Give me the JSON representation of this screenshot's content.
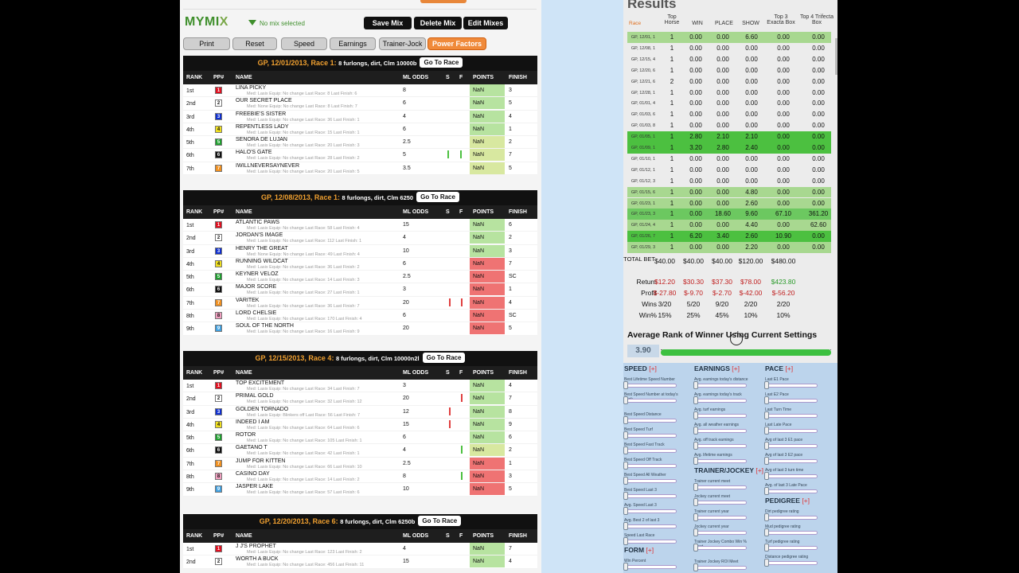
{
  "toolbar": {
    "logo_main": "MYMI",
    "logo_x": "X",
    "no_mix": "No mix selected",
    "save_mix": "Save Mix",
    "delete_mix": "Delete Mix",
    "edit_mixes": "Edit Mixes",
    "filters": [
      "Print",
      "Reset",
      "Speed",
      "Earnings",
      "Trainer-Jock",
      "Power Factors"
    ]
  },
  "columns": [
    "RANK",
    "PP#",
    "NAME",
    "ML ODDS",
    "S",
    "F",
    "POINTS",
    "FINISH"
  ],
  "races": [
    {
      "title": "GP, 12/01/2013, Race 1:",
      "dist": "8 furlongs, dirt, Clm 10000b",
      "go": "Go To Race",
      "horses": [
        {
          "rank": "1st",
          "pp": "1",
          "name": "LINA PICKY",
          "med": "Med: Lasix   Equip: No change   Last Race: 8   Last Finish: 6",
          "odds": "8",
          "points": "NaN",
          "finish": "3",
          "pc": "g",
          "ppc": "#e01020"
        },
        {
          "rank": "2nd",
          "pp": "2",
          "name": "OUR SECRET PLACE",
          "med": "Med: None   Equip: No change   Last Race: 8   Last Finish: 7",
          "odds": "6",
          "points": "NaN",
          "finish": "5",
          "pc": "g",
          "ppc": "#fff"
        },
        {
          "rank": "3rd",
          "pp": "3",
          "name": "FREEBIE'S SISTER",
          "med": "Med: Lasix   Equip: No change   Last Race: 36   Last Finish: 1",
          "odds": "4",
          "points": "NaN",
          "finish": "4",
          "pc": "g",
          "ppc": "#1030d0"
        },
        {
          "rank": "4th",
          "pp": "4",
          "name": "REPENTLESS LADY",
          "med": "Med: Lasix   Equip: No change   Last Race: 15   Last Finish: 1",
          "odds": "6",
          "points": "NaN",
          "finish": "1",
          "pc": "g",
          "ppc": "#f0e020"
        },
        {
          "rank": "5th",
          "pp": "5",
          "name": "SENORA DE LUJAN",
          "med": "Med: Lasix   Equip: No change   Last Race: 20   Last Finish: 3",
          "odds": "2.5",
          "points": "NaN",
          "finish": "2",
          "pc": "y",
          "ppc": "#20a030"
        },
        {
          "rank": "6th",
          "pp": "6",
          "name": "HALO'S GATE",
          "med": "Med: Lasix   Equip: No change   Last Race: 28   Last Finish: 2",
          "odds": "5",
          "points": "NaN",
          "finish": "7",
          "pc": "y",
          "ppc": "#111"
        },
        {
          "rank": "7th",
          "pp": "7",
          "name": "IWILLNEVERSAYNEVER",
          "med": "Med: Lasix   Equip: No change   Last Race: 20   Last Finish: 5",
          "odds": "3.5",
          "points": "NaN",
          "finish": "5",
          "pc": "y",
          "ppc": "#f09020"
        }
      ]
    },
    {
      "title": "GP, 12/08/2013, Race 1:",
      "dist": "8 furlongs, dirt, Clm 6250",
      "go": "Go To Race",
      "horses": [
        {
          "rank": "1st",
          "pp": "1",
          "name": "ATLANTIC PAWS",
          "med": "Med: Lasix   Equip: No change   Last Race: 58   Last Finish: 4",
          "odds": "15",
          "points": "NaN",
          "finish": "6",
          "pc": "g",
          "ppc": "#e01020"
        },
        {
          "rank": "2nd",
          "pp": "2",
          "name": "JORDAN'S IMAGE",
          "med": "Med: Lasix   Equip: No change   Last Race: 112   Last Finish: 1",
          "odds": "4",
          "points": "NaN",
          "finish": "2",
          "pc": "g",
          "ppc": "#fff"
        },
        {
          "rank": "3rd",
          "pp": "3",
          "name": "HENRY THE GREAT",
          "med": "Med: None   Equip: No change   Last Race: 49   Last Finish: 4",
          "odds": "10",
          "points": "NaN",
          "finish": "3",
          "pc": "g",
          "ppc": "#1030d0"
        },
        {
          "rank": "4th",
          "pp": "4",
          "name": "RUNNING WILDCAT",
          "med": "Med: Lasix   Equip: No change   Last Race: 36   Last Finish: 2",
          "odds": "6",
          "points": "NaN",
          "finish": "7",
          "pc": "r",
          "ppc": "#f0e020"
        },
        {
          "rank": "5th",
          "pp": "5",
          "name": "KEYNER VELOZ",
          "med": "Med: Lasix   Equip: No change   Last Race: 14   Last Finish: 3",
          "odds": "2.5",
          "points": "NaN",
          "finish": "SC",
          "pc": "r",
          "ppc": "#20a030"
        },
        {
          "rank": "6th",
          "pp": "6",
          "name": "MAJOR SCORE",
          "med": "Med: Lasix   Equip: No change   Last Race: 27   Last Finish: 1",
          "odds": "3",
          "points": "NaN",
          "finish": "1",
          "pc": "r",
          "ppc": "#111"
        },
        {
          "rank": "7th",
          "pp": "7",
          "name": "VARITEK",
          "med": "Med: Lasix   Equip: No change   Last Race: 36   Last Finish: 7",
          "odds": "20",
          "points": "NaN",
          "finish": "4",
          "pc": "r",
          "ppc": "#f09020"
        },
        {
          "rank": "8th",
          "pp": "8",
          "name": "LORD CHELSIE",
          "med": "Med: Lasix   Equip: No change   Last Race: 170   Last Finish: 4",
          "odds": "6",
          "points": "NaN",
          "finish": "SC",
          "pc": "r",
          "ppc": "#f0a0c0"
        },
        {
          "rank": "9th",
          "pp": "9",
          "name": "SOUL OF THE NORTH",
          "med": "Med: Lasix   Equip: No change   Last Race: 16   Last Finish: 9",
          "odds": "20",
          "points": "NaN",
          "finish": "5",
          "pc": "r",
          "ppc": "#40a0e0"
        }
      ]
    },
    {
      "title": "GP, 12/15/2013, Race 4:",
      "dist": "8 furlongs, dirt, Clm 10000n2l",
      "go": "Go To Race",
      "horses": [
        {
          "rank": "1st",
          "pp": "1",
          "name": "TOP EXCITEMENT",
          "med": "Med: Lasix   Equip: No change   Last Race: 34   Last Finish: 7",
          "odds": "3",
          "points": "NaN",
          "finish": "4",
          "pc": "g",
          "ppc": "#e01020"
        },
        {
          "rank": "2nd",
          "pp": "2",
          "name": "PRIMAL GOLD",
          "med": "Med: Lasix   Equip: No change   Last Race: 32   Last Finish: 12",
          "odds": "20",
          "points": "NaN",
          "finish": "7",
          "pc": "g",
          "ppc": "#fff"
        },
        {
          "rank": "3rd",
          "pp": "3",
          "name": "GOLDEN TORNADO",
          "med": "Med: Lasix   Equip: Blinkers off   Last Race: 56   Last Finish: 7",
          "odds": "12",
          "points": "NaN",
          "finish": "8",
          "pc": "g",
          "ppc": "#1030d0"
        },
        {
          "rank": "4th",
          "pp": "4",
          "name": "INDEED I AM",
          "med": "Med: Lasix   Equip: No change   Last Race: 64   Last Finish: 6",
          "odds": "15",
          "points": "NaN",
          "finish": "9",
          "pc": "g",
          "ppc": "#f0e020"
        },
        {
          "rank": "5th",
          "pp": "5",
          "name": "ROTOR",
          "med": "Med: Lasix   Equip: No change   Last Race: 105   Last Finish: 1",
          "odds": "6",
          "points": "NaN",
          "finish": "6",
          "pc": "g",
          "ppc": "#20a030"
        },
        {
          "rank": "6th",
          "pp": "6",
          "name": "GAETANO T",
          "med": "Med: Lasix   Equip: No change   Last Race: 42   Last Finish: 1",
          "odds": "4",
          "points": "NaN",
          "finish": "2",
          "pc": "y",
          "ppc": "#111"
        },
        {
          "rank": "7th",
          "pp": "7",
          "name": "JUMP FOR KITTEN",
          "med": "Med: Lasix   Equip: No change   Last Race: 66   Last Finish: 10",
          "odds": "2.5",
          "points": "NaN",
          "finish": "1",
          "pc": "r",
          "ppc": "#f09020"
        },
        {
          "rank": "8th",
          "pp": "8",
          "name": "CASINO DAY",
          "med": "Med: Lasix   Equip: No change   Last Race: 14   Last Finish: 2",
          "odds": "8",
          "points": "NaN",
          "finish": "3",
          "pc": "r",
          "ppc": "#f0a0c0"
        },
        {
          "rank": "9th",
          "pp": "9",
          "name": "JASPER LAKE",
          "med": "Med: Lasix   Equip: No change   Last Race: 57   Last Finish: 6",
          "odds": "10",
          "points": "NaN",
          "finish": "5",
          "pc": "r",
          "ppc": "#40a0e0"
        }
      ]
    },
    {
      "title": "GP, 12/20/2013, Race 6:",
      "dist": "8 furlongs, dirt, Clm 6250b",
      "go": "Go To Race",
      "horses": [
        {
          "rank": "1st",
          "pp": "1",
          "name": "J J'S PROPHET",
          "med": "Med: Lasix   Equip: No change   Last Race: 123   Last Finish: 2",
          "odds": "4",
          "points": "NaN",
          "finish": "7",
          "pc": "g",
          "ppc": "#e01020"
        },
        {
          "rank": "2nd",
          "pp": "2",
          "name": "WORTH A BUCK",
          "med": "Med: Lasix   Equip: No change   Last Race: 456   Last Finish: 11",
          "odds": "15",
          "points": "NaN",
          "finish": "4",
          "pc": "g",
          "ppc": "#fff"
        }
      ]
    }
  ],
  "results": {
    "title": "Results",
    "headers": [
      "Race",
      "Top Horse",
      "WIN",
      "PLACE",
      "SHOW",
      "Top 3 Exacta Box",
      "Top 4 Trifecta Box"
    ],
    "rows": [
      [
        "GP, 12/01, 1",
        "1",
        "0.00",
        "0.00",
        "6.60",
        "0.00",
        "0.00",
        "lg"
      ],
      [
        "GP, 12/08, 1",
        "1",
        "0.00",
        "0.00",
        "0.00",
        "0.00",
        "0.00",
        ""
      ],
      [
        "GP, 12/15, 4",
        "1",
        "0.00",
        "0.00",
        "0.00",
        "0.00",
        "0.00",
        ""
      ],
      [
        "GP, 12/20, 6",
        "1",
        "0.00",
        "0.00",
        "0.00",
        "0.00",
        "0.00",
        ""
      ],
      [
        "GP, 12/21, 6",
        "2",
        "0.00",
        "0.00",
        "0.00",
        "0.00",
        "0.00",
        ""
      ],
      [
        "GP, 12/28, 1",
        "1",
        "0.00",
        "0.00",
        "0.00",
        "0.00",
        "0.00",
        ""
      ],
      [
        "GP, 01/01, 4",
        "1",
        "0.00",
        "0.00",
        "0.00",
        "0.00",
        "0.00",
        ""
      ],
      [
        "GP, 01/03, 6",
        "1",
        "0.00",
        "0.00",
        "0.00",
        "0.00",
        "0.00",
        ""
      ],
      [
        "GP, 01/03, 8",
        "1",
        "0.00",
        "0.00",
        "0.00",
        "0.00",
        "0.00",
        ""
      ],
      [
        "GP, 01/05, 1",
        "1",
        "2.80",
        "2.10",
        "2.10",
        "0.00",
        "0.00",
        "dg"
      ],
      [
        "GP, 01/09, 1",
        "1",
        "3.20",
        "2.80",
        "2.40",
        "0.00",
        "0.00",
        "dg"
      ],
      [
        "GP, 01/10, 1",
        "1",
        "0.00",
        "0.00",
        "0.00",
        "0.00",
        "0.00",
        ""
      ],
      [
        "GP, 01/12, 1",
        "1",
        "0.00",
        "0.00",
        "0.00",
        "0.00",
        "0.00",
        ""
      ],
      [
        "GP, 01/12, 3",
        "1",
        "0.00",
        "0.00",
        "0.00",
        "0.00",
        "0.00",
        ""
      ],
      [
        "GP, 01/15, 6",
        "1",
        "0.00",
        "0.00",
        "4.80",
        "0.00",
        "0.00",
        "lg"
      ],
      [
        "GP, 01/23, 1",
        "1",
        "0.00",
        "0.00",
        "2.60",
        "0.00",
        "0.00",
        "lg"
      ],
      [
        "GP, 01/23, 3",
        "1",
        "0.00",
        "18.60",
        "9.60",
        "67.10",
        "361.20",
        "mg"
      ],
      [
        "GP, 01/24, 4",
        "1",
        "0.00",
        "0.00",
        "4.40",
        "0.00",
        "62.60",
        "lg"
      ],
      [
        "GP, 01/26, 7",
        "1",
        "6.20",
        "3.40",
        "2.60",
        "10.90",
        "0.00",
        "dg"
      ],
      [
        "GP, 01/29, 3",
        "1",
        "0.00",
        "0.00",
        "2.20",
        "0.00",
        "0.00",
        "lg"
      ]
    ],
    "total_label": "TOTAL BET",
    "totals": [
      "$40.00",
      "$40.00",
      "$40.00",
      "$120.00",
      "$480.00"
    ],
    "return_label": "Return",
    "returns": [
      "$12.20",
      "$30.30",
      "$37.30",
      "$78.00",
      "$423.80"
    ],
    "profit_label": "Profit",
    "profits": [
      "$-27.80",
      "$-9.70",
      "$-2.70",
      "$-42.00",
      "$-56.20"
    ],
    "wins_label": "Wins",
    "wins": [
      "3/20",
      "5/20",
      "9/20",
      "2/20",
      "2/20"
    ],
    "winpct_label": "Win%",
    "winpct": [
      "15%",
      "25%",
      "45%",
      "10%",
      "10%"
    ],
    "avg_title": "Average Rank of Winner Using Current Settings",
    "avg_value": "3.90"
  },
  "factors": {
    "speed": {
      "title": "SPEED",
      "plus": "[+]",
      "items": [
        "Best Lifetime Speed Number",
        "Best Speed Number at today's track",
        "Best Speed Distance",
        "Best Speed Turf",
        "Best Speed Fast Track",
        "Best Speed Off Track",
        "Best Speed All Weather",
        "Best Speed Last 3",
        "Avg. Speed Last 3",
        "Avg. Best 2 of last 3",
        "Speed Last Race"
      ]
    },
    "form": {
      "title": "FORM",
      "plus": "[+]",
      "items": [
        "Win Percent"
      ]
    },
    "earnings": {
      "title": "EARNINGS",
      "plus": "[+]",
      "items": [
        "Avg. earnings today's distance",
        "Avg. earnings today's track",
        "Avg. turf earnings",
        "Avg. all weather earnings",
        "Avg. off track earnings",
        "Avg. lifetime earnings"
      ]
    },
    "trainer": {
      "title": "TRAINER/JOCKEY",
      "plus": "[+]",
      "items": [
        "Trainer current meet",
        "Jockey current meet",
        "Trainer current year",
        "Jockey current year",
        "Trainer Jockey Combo Win % Meet",
        "Trainer Jockey ROI Meet"
      ]
    },
    "pace": {
      "title": "PACE",
      "plus": "[+]",
      "items": [
        "Last E1 Pace",
        "Last E2 Pace",
        "Last Turn Time",
        "Last Late Pace",
        "Avg of last 3 E1 pace",
        "Avg of last 3 E2 pace",
        "Avg of last 3 turn time",
        "Avg. of last 3 Late Pace"
      ]
    },
    "pedigree": {
      "title": "PEDIGREE",
      "plus": "[+]",
      "items": [
        "Dirt pedigree rating",
        "Mud pedigree rating",
        "Turf pedigree rating",
        "Distance pedigree rating"
      ]
    }
  }
}
